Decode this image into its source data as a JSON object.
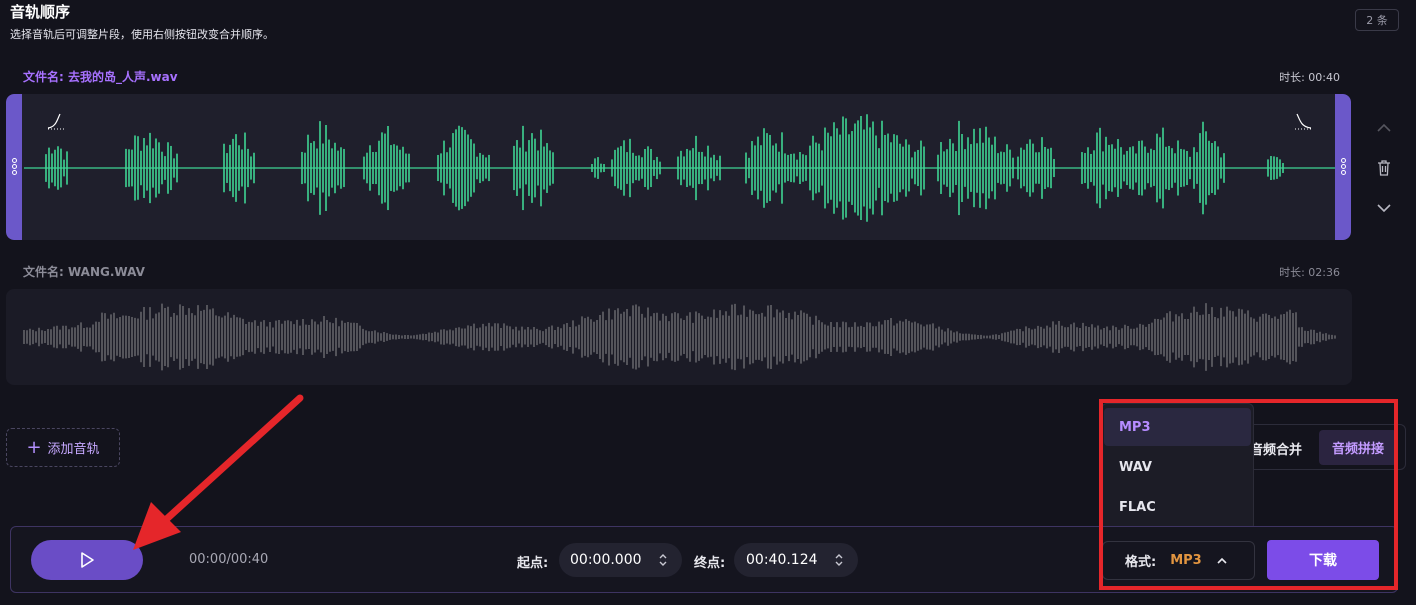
{
  "header": {
    "title": "音轨顺序",
    "subtitle": "选择音轨后可调整片段，使用右侧按钮改变合并顺序。",
    "count_badge": "2 条"
  },
  "tracks": [
    {
      "filename": "文件名: 去我的岛_人声.wav",
      "duration": "时长: 00:40",
      "selected": true,
      "wave_color": "#3fd494"
    },
    {
      "filename": "文件名: WANG.WAV",
      "duration": "时长: 02:36",
      "selected": false,
      "wave_color": "#6c6c72"
    }
  ],
  "track_controls": {
    "move_up": "chevron-up-icon",
    "delete": "trash-icon",
    "move_down": "chevron-down-icon"
  },
  "add_track_label": "添加音轨",
  "modes": {
    "merge": "音频合并",
    "splice": "音频拼接",
    "active": "splice"
  },
  "format_dropdown": {
    "options": [
      "MP3",
      "WAV",
      "FLAC"
    ],
    "selected": "MP3"
  },
  "player": {
    "time": "00:00/00:40",
    "start_label": "起点:",
    "start_value": "00:00.000",
    "end_label": "终点:",
    "end_value": "00:40.124",
    "format_label": "格式:",
    "format_value": "MP3",
    "download_label": "下载"
  },
  "colors": {
    "accent": "#7c4ce8",
    "handle": "#6b58c9",
    "format_value": "#e29540",
    "annotation_red": "#e5262a"
  }
}
